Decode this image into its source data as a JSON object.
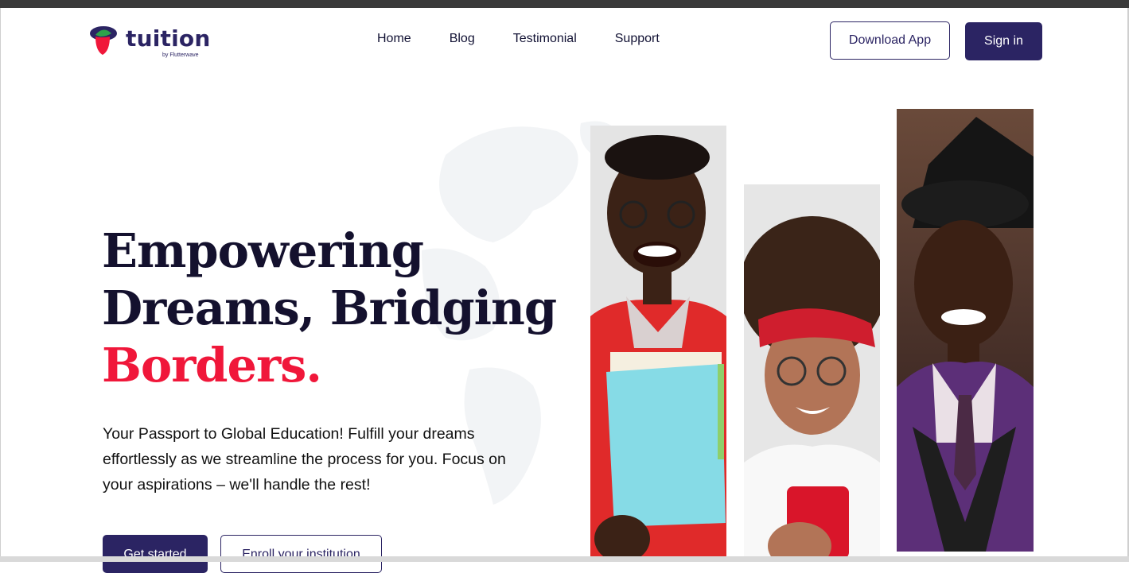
{
  "header": {
    "logo": {
      "word": "tuition",
      "sub": "by Flutterwave"
    },
    "nav": [
      {
        "label": "Home"
      },
      {
        "label": "Blog"
      },
      {
        "label": "Testimonial"
      },
      {
        "label": "Support"
      }
    ],
    "download_label": "Download App",
    "signin_label": "Sign in"
  },
  "hero": {
    "headline_line1": "Empowering",
    "headline_line2": "Dreams, Bridging",
    "headline_accent": "Borders.",
    "subtext": "Your Passport to Global Education! Fulfill your dreams effortlessly as we streamline the process for you. Focus on your aspirations – we'll handle the rest!",
    "get_started_label": "Get started",
    "enroll_label": "Enroll your institution"
  },
  "colors": {
    "brand": "#2b2463",
    "accent": "#f0173a",
    "text": "#14112e"
  }
}
